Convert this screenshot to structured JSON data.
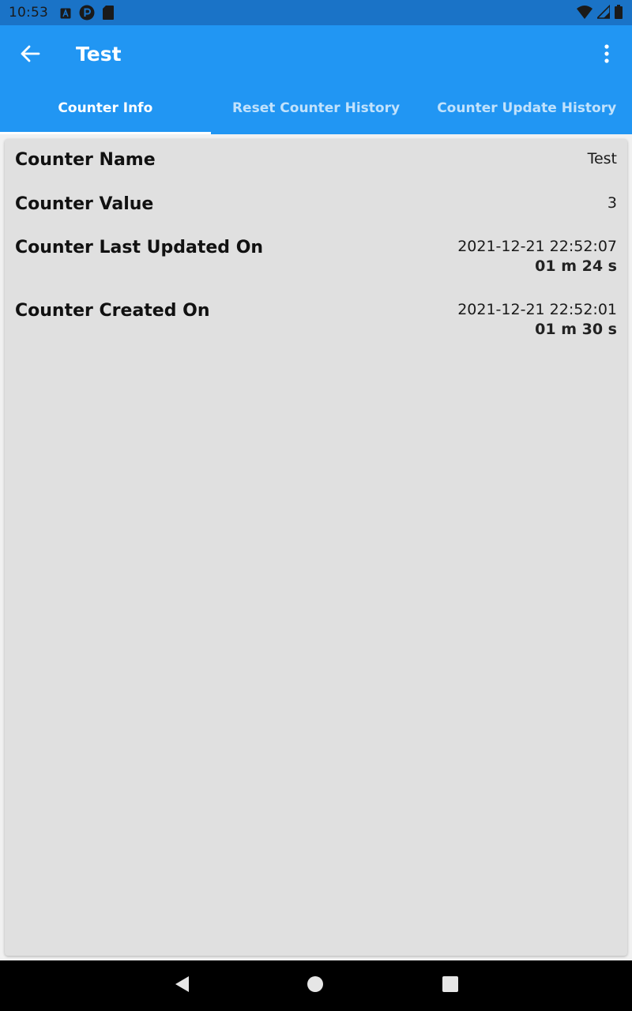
{
  "status_bar": {
    "time": "10:53",
    "icons_left": [
      "a-box-icon",
      "p-circle-icon",
      "sd-card-icon"
    ],
    "icons_right": [
      "wifi-icon",
      "signal-icon",
      "battery-icon"
    ]
  },
  "app_bar": {
    "title": "Test",
    "back_icon": "arrow-back-icon",
    "more_icon": "more-vert-icon",
    "tabs": [
      {
        "label": "Counter Info",
        "active": true
      },
      {
        "label": "Reset Counter History",
        "active": false
      },
      {
        "label": "Counter Update History",
        "active": false
      }
    ]
  },
  "details": {
    "name": {
      "label": "Counter Name",
      "value": "Test"
    },
    "value": {
      "label": "Counter Value",
      "value": "3"
    },
    "last_updated": {
      "label": "Counter Last Updated On",
      "value": "2021-12-21 22:52:07",
      "elapsed": "01 m 24 s"
    },
    "created": {
      "label": "Counter Created On",
      "value": "2021-12-21 22:52:01",
      "elapsed": "01 m 30 s"
    }
  },
  "nav_bar": {
    "icons": [
      "back-triangle-icon",
      "home-circle-icon",
      "recents-square-icon"
    ]
  },
  "colors": {
    "status_bar": "#1a73c7",
    "app_bar": "#2196f3",
    "card": "#e0e0e0",
    "nav_bar": "#000000"
  }
}
